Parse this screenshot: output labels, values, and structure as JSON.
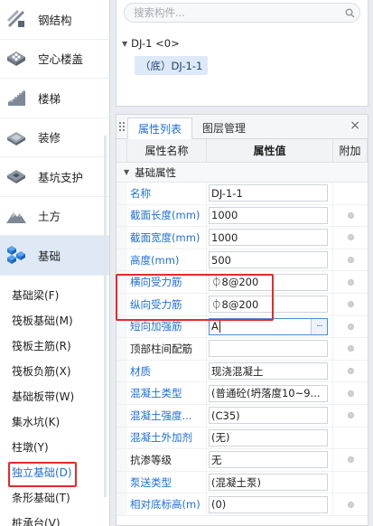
{
  "sidebar": {
    "categories": [
      {
        "label": "钢结构",
        "icon": "steel-structure-icon"
      },
      {
        "label": "空心楼盖",
        "icon": "hollow-floor-icon"
      },
      {
        "label": "楼梯",
        "icon": "stairs-icon"
      },
      {
        "label": "装修",
        "icon": "decoration-icon"
      },
      {
        "label": "基坑支护",
        "icon": "pit-support-icon"
      },
      {
        "label": "土方",
        "icon": "earthwork-icon"
      },
      {
        "label": "基础",
        "icon": "foundation-icon",
        "active": true
      }
    ],
    "subitems": [
      {
        "label": "基础梁(F)"
      },
      {
        "label": "筏板基础(M)"
      },
      {
        "label": "筏板主筋(R)"
      },
      {
        "label": "筏板负筋(X)"
      },
      {
        "label": "基础板带(W)"
      },
      {
        "label": "集水坑(K)"
      },
      {
        "label": "柱墩(Y)"
      },
      {
        "label": "独立基础(D)",
        "active": true
      },
      {
        "label": "条形基础(T)"
      },
      {
        "label": "桩承台(V)"
      }
    ]
  },
  "tree": {
    "search_placeholder": "搜索构件...",
    "root": "DJ-1 <0>",
    "child": "（底）DJ-1-1"
  },
  "props": {
    "tabs": [
      {
        "label": "属性列表",
        "active": true
      },
      {
        "label": "图层管理",
        "active": false
      }
    ],
    "close": "×",
    "headers": {
      "name": "属性名称",
      "value": "属性值",
      "extra": "附加"
    },
    "group": "基础属性",
    "rows": [
      {
        "name": "名称",
        "value": "DJ-1-1",
        "color": "blue",
        "dot": false
      },
      {
        "name": "截面长度(mm)",
        "value": "1000",
        "color": "blue",
        "dot": true
      },
      {
        "name": "截面宽度(mm)",
        "value": "1000",
        "color": "blue",
        "dot": true
      },
      {
        "name": "高度(mm)",
        "value": "500",
        "color": "blue",
        "dot": true
      },
      {
        "name": "横向受力筋",
        "value": "⏀8@200",
        "color": "blue",
        "dot": true
      },
      {
        "name": "纵向受力筋",
        "value": "⏀8@200",
        "color": "blue",
        "dot": true
      },
      {
        "name": "短向加强筋",
        "value": "A",
        "color": "blue",
        "dot": true,
        "focused": true
      },
      {
        "name": "顶部柱间配筋",
        "value": "",
        "color": "black",
        "dot": true
      },
      {
        "name": "材质",
        "value": "现浇混凝土",
        "color": "blue",
        "dot": true
      },
      {
        "name": "混凝土类型",
        "value": "(普通砼(坍落度10~9...",
        "color": "blue",
        "dot": true
      },
      {
        "name": "混凝土强度...",
        "value": "(C35)",
        "color": "blue",
        "dot": true
      },
      {
        "name": "混凝土外加剂",
        "value": "(无)",
        "color": "blue",
        "dot": false
      },
      {
        "name": "抗渗等级",
        "value": "无",
        "color": "black",
        "dot": true
      },
      {
        "name": "泵送类型",
        "value": "(混凝土泵)",
        "color": "blue",
        "dot": false
      },
      {
        "name": "相对底标高(m)",
        "value": "(0)",
        "color": "blue",
        "dot": true
      }
    ]
  },
  "colors": {
    "accent": "#1e6fd9",
    "highlight": "#e52a2a",
    "active_bg": "#dfe9f5"
  }
}
